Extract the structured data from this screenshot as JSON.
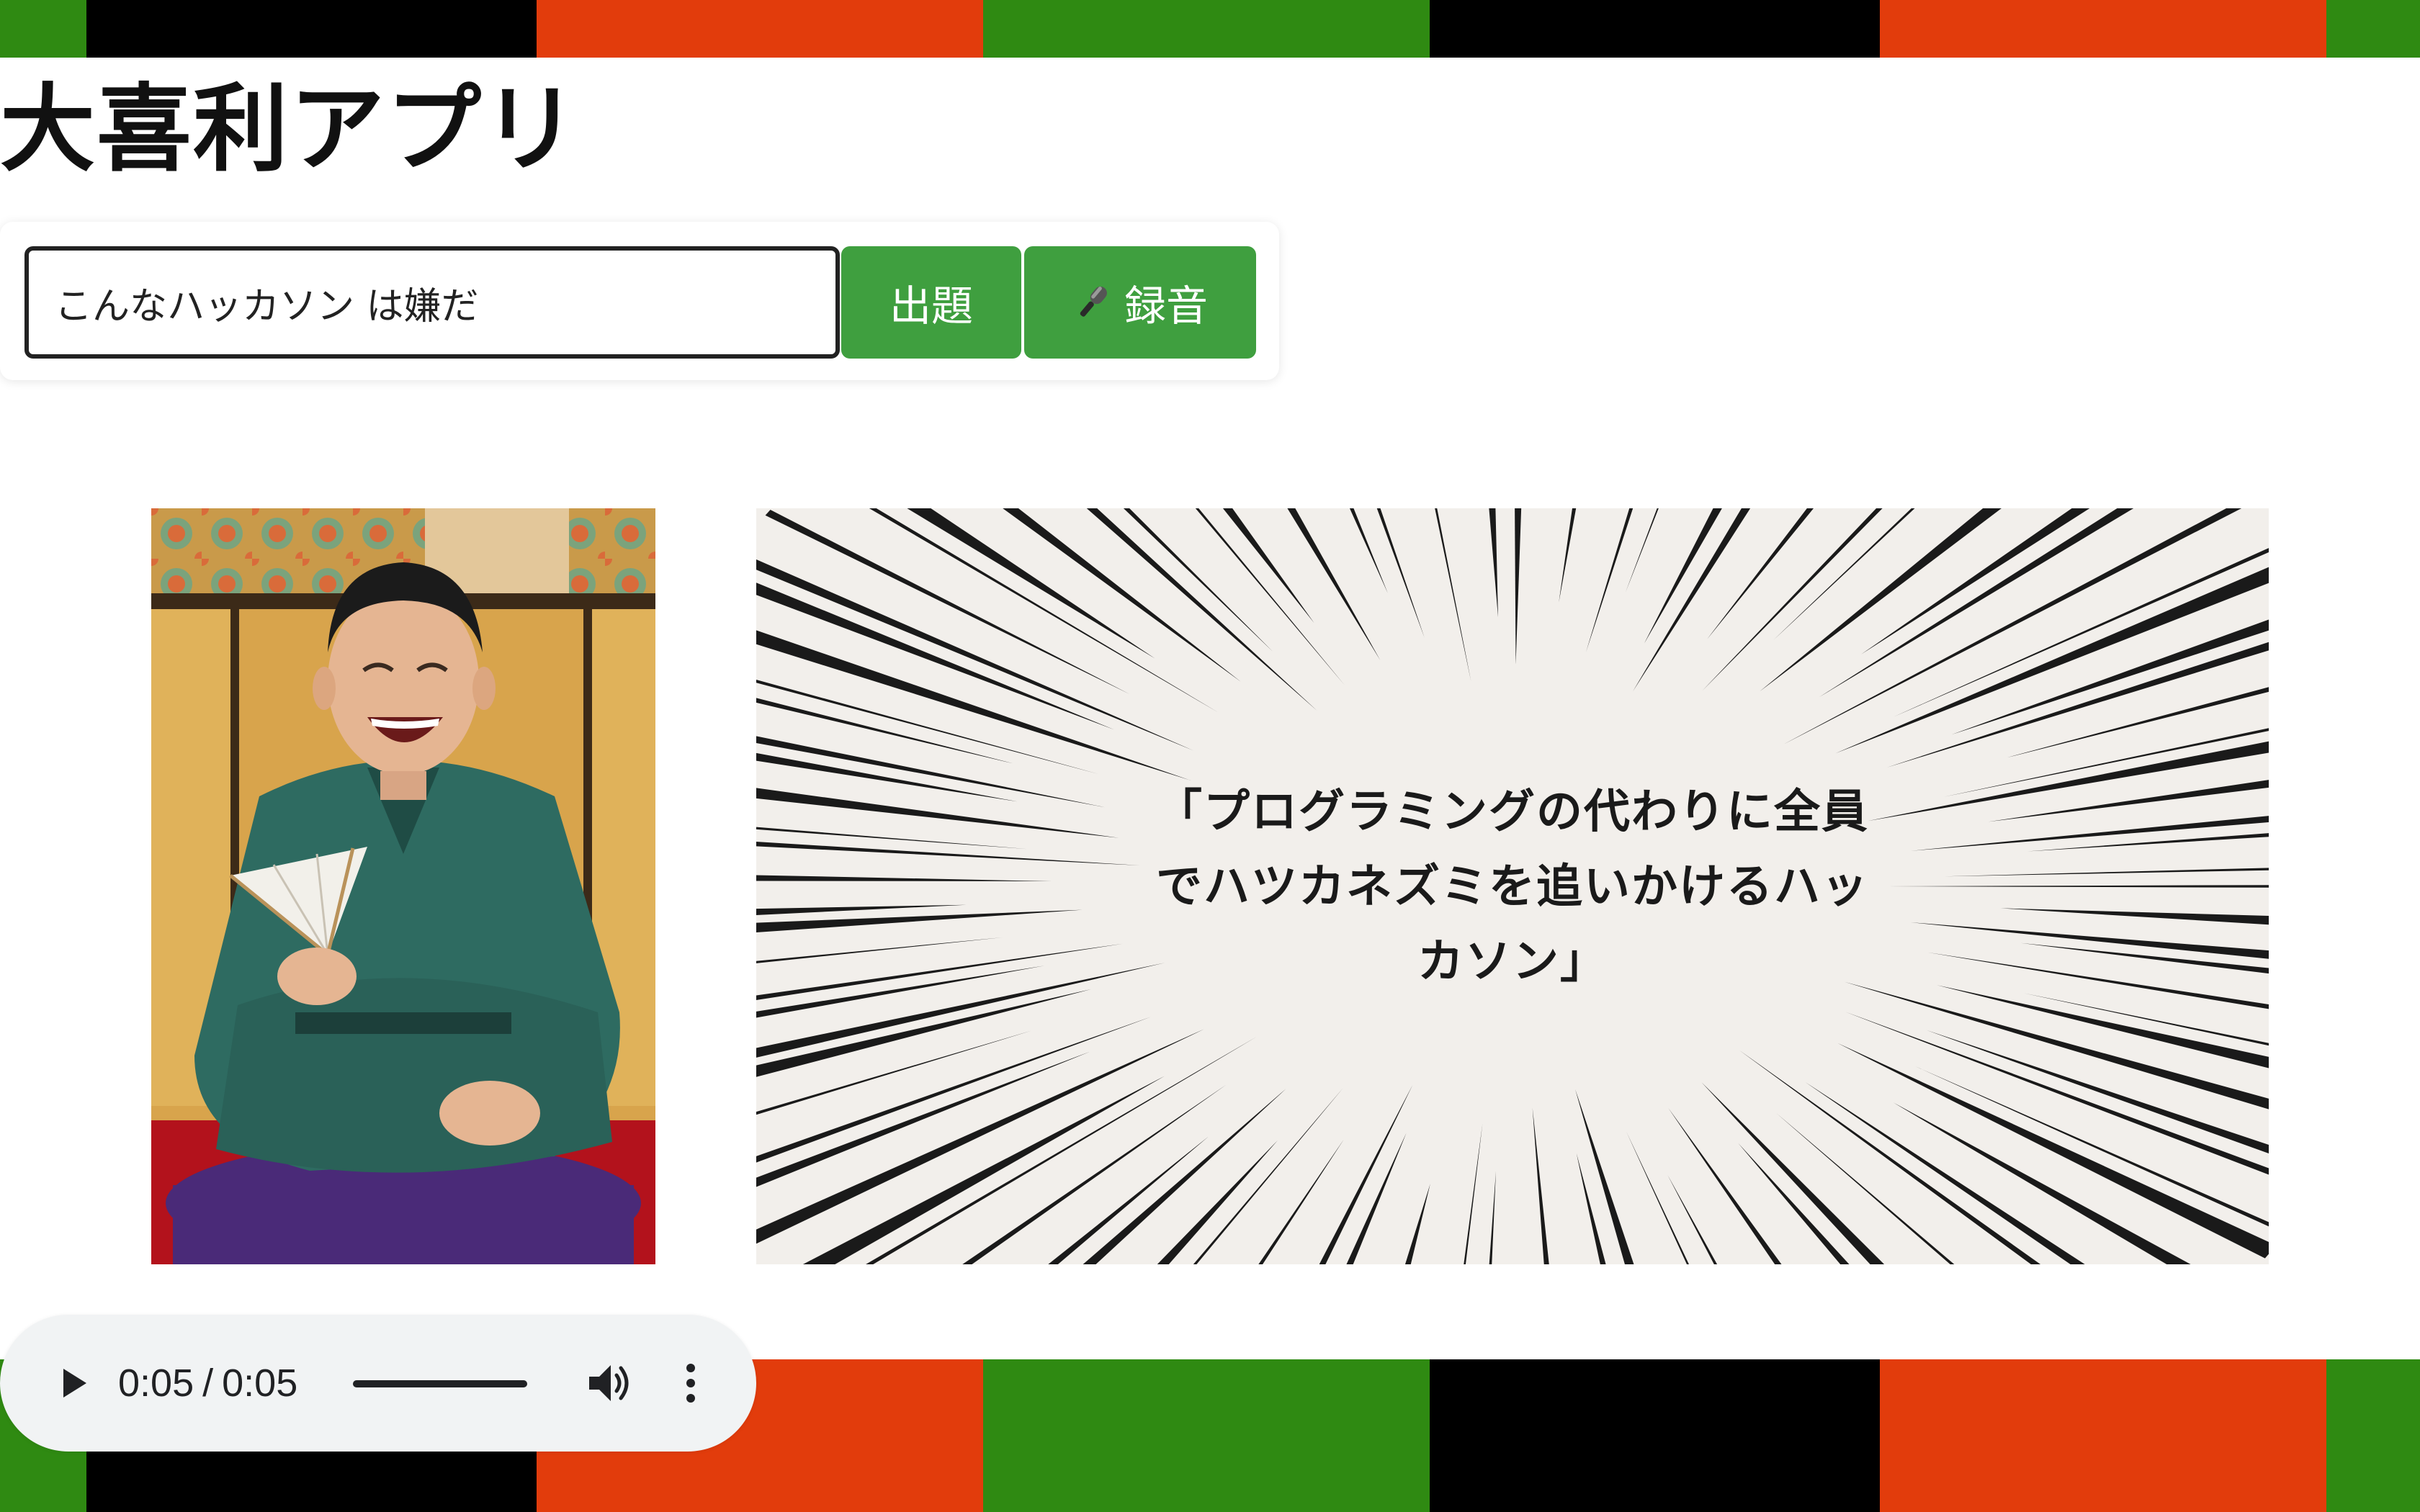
{
  "app": {
    "title": "大喜利アプリ"
  },
  "prompt": {
    "value": "こんなハッカソン は嫌だ",
    "placeholder": ""
  },
  "buttons": {
    "submit_label": "出題",
    "record_label": "録音",
    "record_icon": "microphone-icon"
  },
  "answer": {
    "text": "「プログラミングの代わりに全員でハツカネズミを追いかけるハッカソン」"
  },
  "player": {
    "current_time": "0:05",
    "duration": "0:05",
    "separator": "/",
    "progress": 1.0,
    "icons": [
      "play-icon",
      "volume-icon",
      "more-vert-icon"
    ]
  },
  "theme": {
    "accent": "#3f9f3f",
    "curtain_colors": [
      "#2f8a12",
      "#000000",
      "#e23c0c"
    ]
  }
}
